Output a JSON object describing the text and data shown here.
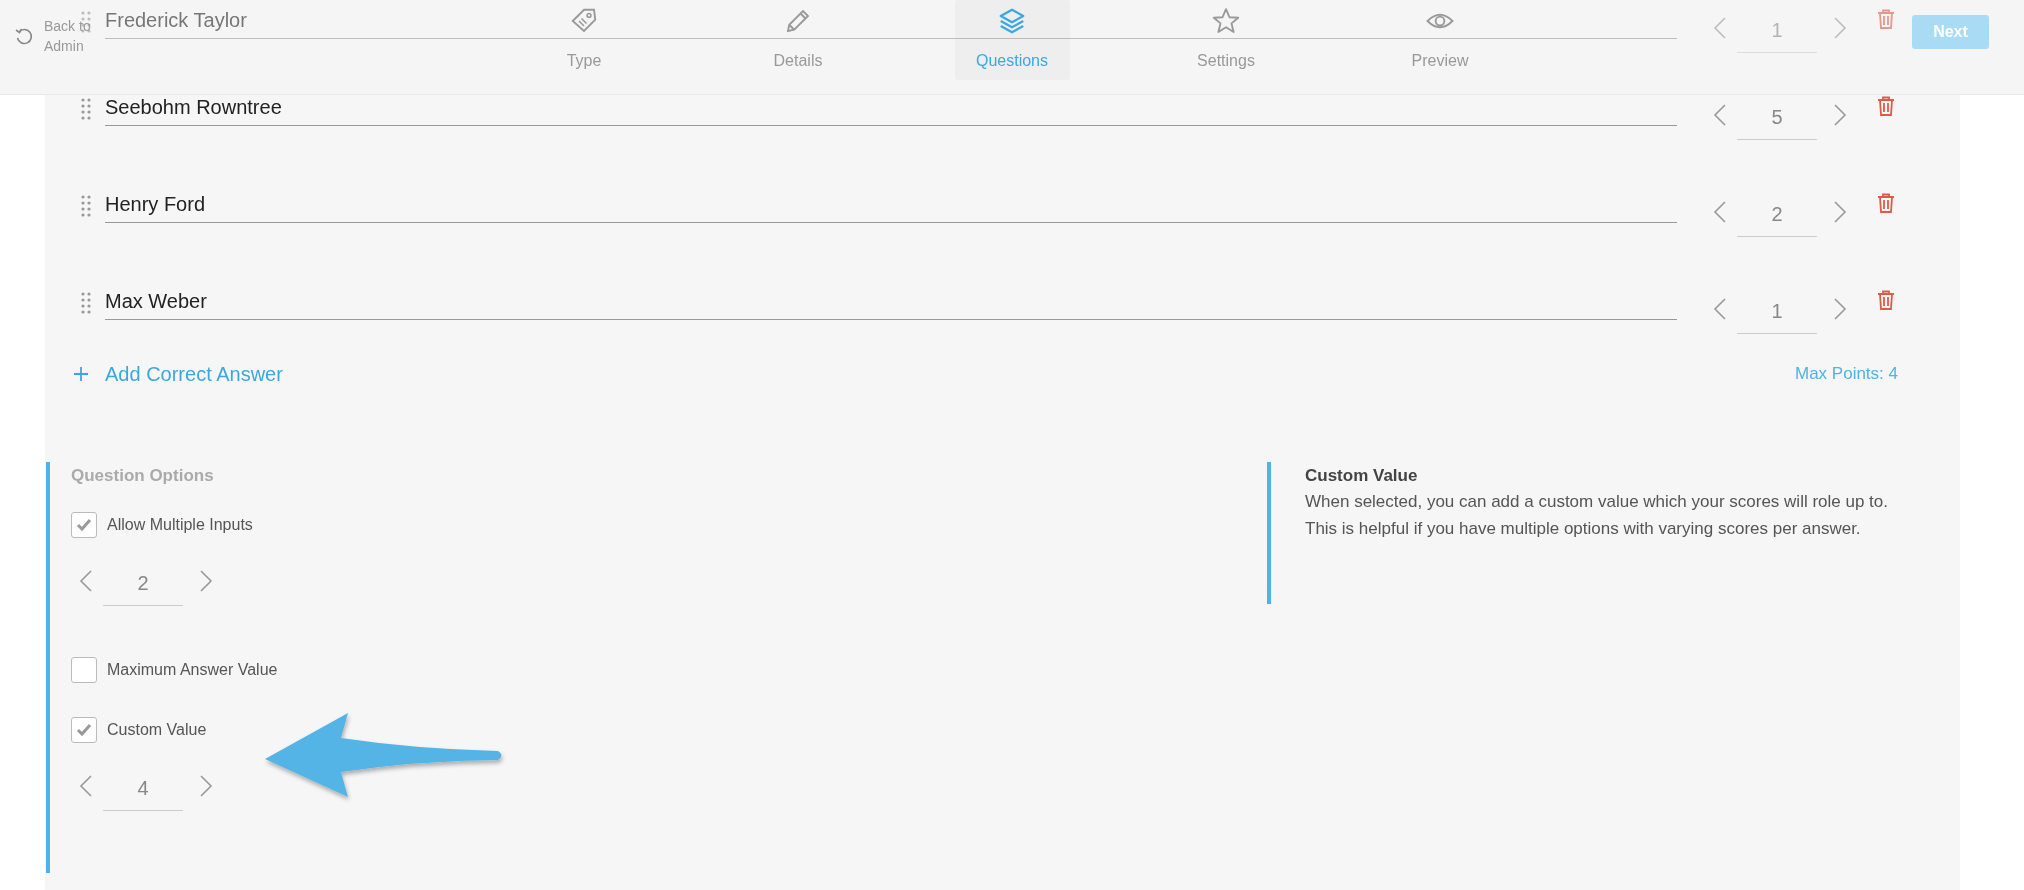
{
  "header": {
    "back_link": "Back to Admin",
    "tabs": [
      {
        "label": "Type",
        "selected": false
      },
      {
        "label": "Details",
        "selected": false
      },
      {
        "label": "Questions",
        "selected": true
      },
      {
        "label": "Settings",
        "selected": false
      },
      {
        "label": "Preview",
        "selected": false
      }
    ],
    "next_button": {
      "label": "Next",
      "disabled": true
    }
  },
  "answers": [
    {
      "text": "Frederick Taylor",
      "points": "1"
    },
    {
      "text": "Seebohm Rowntree",
      "points": "5"
    },
    {
      "text": "Henry Ford",
      "points": "2"
    },
    {
      "text": "Max Weber",
      "points": "1"
    }
  ],
  "add_answer_link": "Add Correct Answer",
  "max_points": "Max Points: 4",
  "question_options": {
    "title": "Question Options",
    "options": [
      {
        "label": "Allow Multiple Inputs",
        "checked": true,
        "value": "2"
      },
      {
        "label": "Maximum Answer Value",
        "checked": false
      },
      {
        "label": "Custom Value",
        "checked": true,
        "value": "4"
      }
    ]
  },
  "help": {
    "title": "Custom Value",
    "text": "When selected, you can add a custom value which your scores will role up to. This is helpful if you have multiple options with varying scores per answer."
  }
}
